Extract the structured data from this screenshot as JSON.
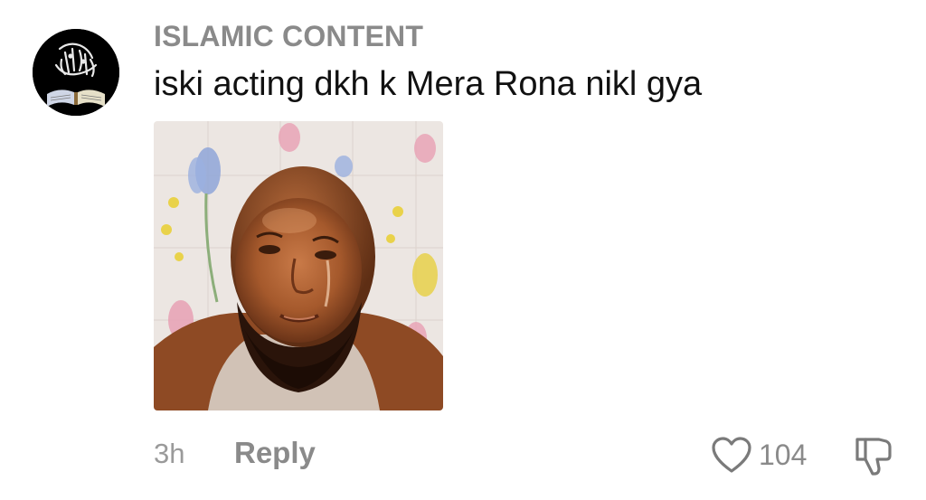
{
  "comment": {
    "username": "ISLAMIC CONTENT",
    "text": "iski acting dkh k Mera Rona nikl gya",
    "timestamp": "3h",
    "reply_label": "Reply",
    "like_count": "104",
    "avatar_icon": "quran-calligraphy-logo",
    "attachment_icon": "photo-man-crying"
  },
  "colors": {
    "username": "#8a8a8a",
    "text": "#111111",
    "meta": "#9a9a9a",
    "avatar_bg": "#000000"
  }
}
